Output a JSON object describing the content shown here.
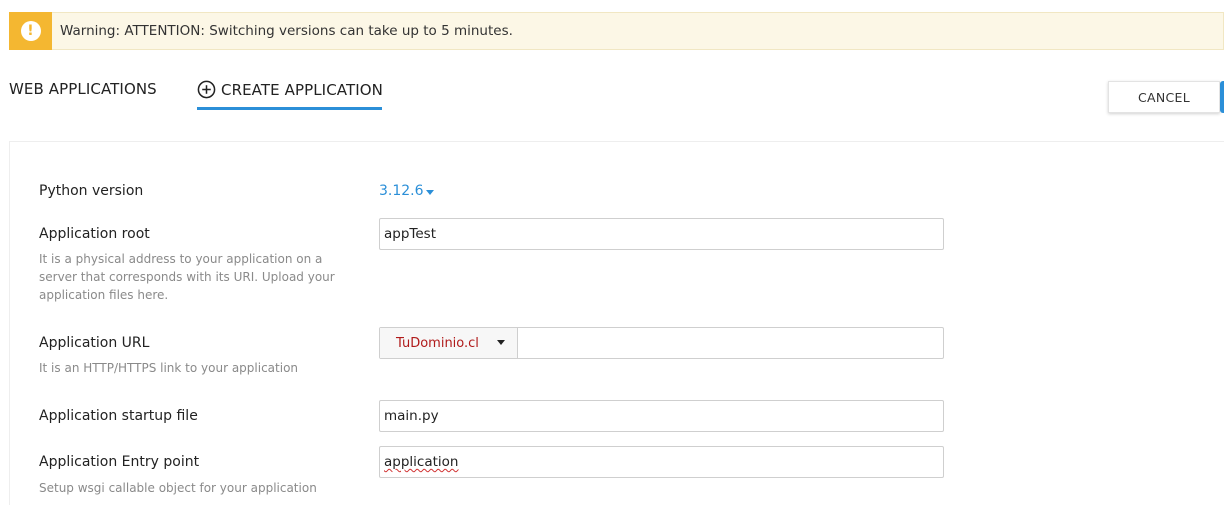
{
  "alert": {
    "icon": "exclamation-icon",
    "text": "Warning: ATTENTION: Switching versions can take up to 5 minutes."
  },
  "tabs": {
    "web_applications": "WEB APPLICATIONS",
    "create_application": "CREATE APPLICATION"
  },
  "toolbar": {
    "cancel_label": "CANCEL"
  },
  "form": {
    "python_version": {
      "label": "Python version",
      "value": "3.12.6"
    },
    "app_root": {
      "label": "Application root",
      "value": "appTest",
      "hint": "It is a physical address to your application on a server that corresponds with its URI. Upload your application files here."
    },
    "app_url": {
      "label": "Application URL",
      "domain": "TuDominio.cl",
      "path": "",
      "hint": "It is an HTTP/HTTPS link to your application"
    },
    "startup_file": {
      "label": "Application startup file",
      "value": "main.py"
    },
    "entry_point": {
      "label": "Application Entry point",
      "value": "application",
      "hint": "Setup wsgi callable object for your application"
    }
  },
  "colors": {
    "accent": "#2b8fd8",
    "warning": "#f4b731",
    "warning_bg": "#fcf7e6",
    "domain_text": "#b01a1a"
  }
}
